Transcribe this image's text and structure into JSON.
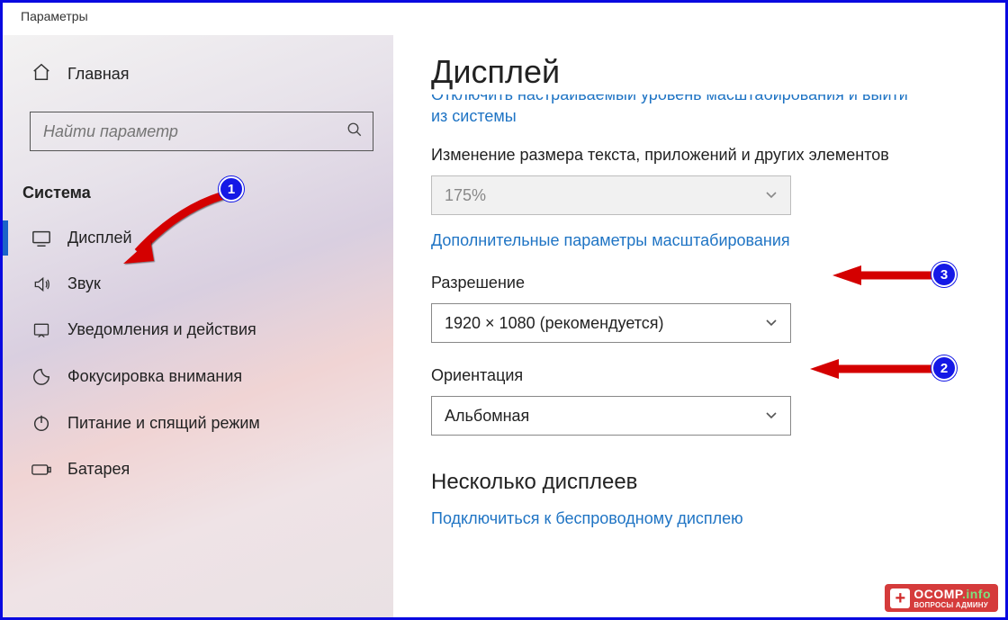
{
  "window_title": "Параметры",
  "sidebar": {
    "home_label": "Главная",
    "search_placeholder": "Найти параметр",
    "section": "Система",
    "items": [
      {
        "label": "Дисплей",
        "icon": "display",
        "selected": true
      },
      {
        "label": "Звук",
        "icon": "sound",
        "selected": false
      },
      {
        "label": "Уведомления и действия",
        "icon": "notifications",
        "selected": false
      },
      {
        "label": "Фокусировка внимания",
        "icon": "focus",
        "selected": false
      },
      {
        "label": "Питание и спящий режим",
        "icon": "power",
        "selected": false
      },
      {
        "label": "Батарея",
        "icon": "battery",
        "selected": false
      }
    ]
  },
  "main": {
    "title": "Дисплей",
    "truncated_link_top": "Отключить настраиваемый уровень масштабирования и выйти",
    "truncated_link_bottom": "из системы",
    "scale": {
      "label": "Изменение размера текста, приложений и других элементов",
      "value": "175%",
      "advanced_link": "Дополнительные параметры масштабирования"
    },
    "resolution": {
      "label": "Разрешение",
      "value": "1920 × 1080 (рекомендуется)"
    },
    "orientation": {
      "label": "Ориентация",
      "value": "Альбомная"
    },
    "multi_heading": "Несколько дисплеев",
    "wireless_link": "Подключиться к беспроводному дисплею"
  },
  "annotations": {
    "badges": {
      "b1": "1",
      "b2": "2",
      "b3": "3"
    },
    "watermark": {
      "brand": "OCOMP",
      "tld": ".info",
      "sub": "ВОПРОСЫ АДМИНУ"
    }
  }
}
